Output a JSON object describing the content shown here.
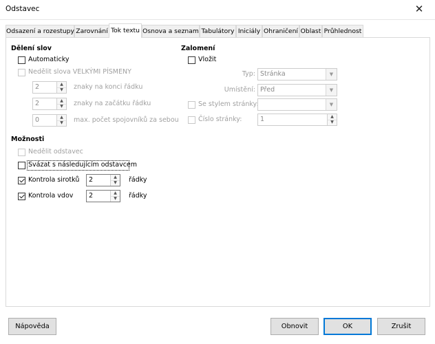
{
  "window": {
    "title": "Odstavec",
    "close_glyph": "✕"
  },
  "tabs": [
    {
      "label": "Odsazení a rozestupy",
      "active": false
    },
    {
      "label": "Zarovnání",
      "active": false
    },
    {
      "label": "Tok textu",
      "active": true
    },
    {
      "label": "Osnova a seznam",
      "active": false
    },
    {
      "label": "Tabulátory",
      "active": false
    },
    {
      "label": "Iniciály",
      "active": false
    },
    {
      "label": "Ohraničení",
      "active": false
    },
    {
      "label": "Oblast",
      "active": false
    },
    {
      "label": "Průhlednost",
      "active": false
    }
  ],
  "hyphenation": {
    "heading": "Dělení slov",
    "automatic": {
      "label": "Automaticky",
      "checked": false,
      "enabled": true
    },
    "no_caps": {
      "label": "Nedělit slova VELKÝMI PÍSMENY",
      "checked": false,
      "enabled": false
    },
    "end_chars": {
      "value": "2",
      "label": "znaky na konci řádku"
    },
    "start_chars": {
      "value": "2",
      "label": "znaky na začátku řádku"
    },
    "max_hyphens": {
      "value": "0",
      "label": "max. počet spojovníků za sebou"
    }
  },
  "breaks": {
    "heading": "Zalomení",
    "insert": {
      "label": "Vložit",
      "checked": false,
      "enabled": true
    },
    "type": {
      "label": "Typ:",
      "value": "Stránka"
    },
    "position": {
      "label": "Umístění:",
      "value": "Před"
    },
    "page_style": {
      "label": "Se stylem stránky:",
      "value": ""
    },
    "page_number": {
      "label": "Číslo stránky:",
      "value": "1"
    }
  },
  "options": {
    "heading": "Možnosti",
    "no_split": {
      "label": "Nedělit odstavec",
      "checked": false,
      "enabled": false
    },
    "keep_next": {
      "label": "Svázat s následujícím odstavcem",
      "checked": false,
      "enabled": true
    },
    "orphan": {
      "label": "Kontrola sirotků",
      "checked": true,
      "value": "2",
      "unit": "řádky"
    },
    "widow": {
      "label": "Kontrola vdov",
      "checked": true,
      "value": "2",
      "unit": "řádky"
    }
  },
  "buttons": {
    "help": "Nápověda",
    "reset": "Obnovit",
    "ok": "OK",
    "cancel": "Zrušit"
  },
  "colors": {
    "accent": "#0078d7",
    "disabled_text": "#a0a0a0",
    "button_bg": "#e1e1e1"
  }
}
